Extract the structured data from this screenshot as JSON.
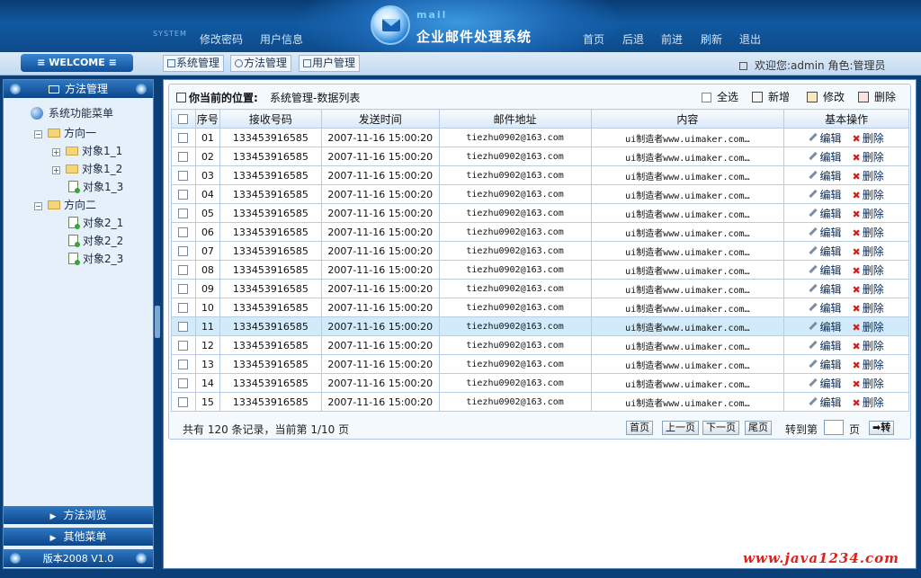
{
  "header": {
    "system_tag": "SYSTEM",
    "left_links": [
      "修改密码",
      "用户信息"
    ],
    "right_links": [
      "首页",
      "后退",
      "前进",
      "刷新",
      "退出"
    ],
    "logo_word": "mail",
    "title": "企业邮件处理系统"
  },
  "navbar": {
    "welcome": "≡ WELCOME ≡",
    "tabs": [
      "系统管理",
      "方法管理",
      "用户管理"
    ],
    "welcome_user": "欢迎您:admin 角色:管理员"
  },
  "sidebar": {
    "top_header": "方法管理",
    "tree": {
      "root": "系统功能菜单",
      "groups": [
        {
          "label": "方向一",
          "items": [
            "对象1_1",
            "对象1_2",
            "对象1_3"
          ]
        },
        {
          "label": "方向二",
          "items": [
            "对象2_1",
            "对象2_2",
            "对象2_3"
          ]
        }
      ]
    },
    "bottom_headers": [
      "方法浏览",
      "其他菜单"
    ],
    "version": "版本2008 V1.0"
  },
  "main": {
    "position_label": "你当前的位置:",
    "position_value": "系统管理-数据列表",
    "toolbar": {
      "select_all": "全选",
      "add": "新增",
      "edit": "修改",
      "delete": "删除"
    },
    "columns": [
      "序号",
      "接收号码",
      "发送时间",
      "邮件地址",
      "内容",
      "基本操作"
    ],
    "row_actions": {
      "edit": "编辑",
      "delete": "删除"
    },
    "rows": [
      {
        "no": "01",
        "phone": "133453916585",
        "time": "2007-11-16 15:00:20",
        "email": "tiezhu0902@163.com",
        "content": "ui制造者www.uimaker.com…"
      },
      {
        "no": "02",
        "phone": "133453916585",
        "time": "2007-11-16 15:00:20",
        "email": "tiezhu0902@163.com",
        "content": "ui制造者www.uimaker.com…"
      },
      {
        "no": "03",
        "phone": "133453916585",
        "time": "2007-11-16 15:00:20",
        "email": "tiezhu0902@163.com",
        "content": "ui制造者www.uimaker.com…"
      },
      {
        "no": "04",
        "phone": "133453916585",
        "time": "2007-11-16 15:00:20",
        "email": "tiezhu0902@163.com",
        "content": "ui制造者www.uimaker.com…"
      },
      {
        "no": "05",
        "phone": "133453916585",
        "time": "2007-11-16 15:00:20",
        "email": "tiezhu0902@163.com",
        "content": "ui制造者www.uimaker.com…"
      },
      {
        "no": "06",
        "phone": "133453916585",
        "time": "2007-11-16 15:00:20",
        "email": "tiezhu0902@163.com",
        "content": "ui制造者www.uimaker.com…"
      },
      {
        "no": "07",
        "phone": "133453916585",
        "time": "2007-11-16 15:00:20",
        "email": "tiezhu0902@163.com",
        "content": "ui制造者www.uimaker.com…"
      },
      {
        "no": "08",
        "phone": "133453916585",
        "time": "2007-11-16 15:00:20",
        "email": "tiezhu0902@163.com",
        "content": "ui制造者www.uimaker.com…"
      },
      {
        "no": "09",
        "phone": "133453916585",
        "time": "2007-11-16 15:00:20",
        "email": "tiezhu0902@163.com",
        "content": "ui制造者www.uimaker.com…"
      },
      {
        "no": "10",
        "phone": "133453916585",
        "time": "2007-11-16 15:00:20",
        "email": "tiezhu0902@163.com",
        "content": "ui制造者www.uimaker.com…"
      },
      {
        "no": "11",
        "phone": "133453916585",
        "time": "2007-11-16 15:00:20",
        "email": "tiezhu0902@163.com",
        "content": "ui制造者www.uimaker.com…",
        "highlight": true
      },
      {
        "no": "12",
        "phone": "133453916585",
        "time": "2007-11-16 15:00:20",
        "email": "tiezhu0902@163.com",
        "content": "ui制造者www.uimaker.com…"
      },
      {
        "no": "13",
        "phone": "133453916585",
        "time": "2007-11-16 15:00:20",
        "email": "tiezhu0902@163.com",
        "content": "ui制造者www.uimaker.com…"
      },
      {
        "no": "14",
        "phone": "133453916585",
        "time": "2007-11-16 15:00:20",
        "email": "tiezhu0902@163.com",
        "content": "ui制造者www.uimaker.com…"
      },
      {
        "no": "15",
        "phone": "133453916585",
        "time": "2007-11-16 15:00:20",
        "email": "tiezhu0902@163.com",
        "content": "ui制造者www.uimaker.com…"
      }
    ],
    "pager": {
      "info": "共有 120 条记录，当前第 1/10 页",
      "buttons": [
        "首页",
        "上一页",
        "下一页",
        "尾页"
      ],
      "goto_label": "转到第",
      "goto_value": "",
      "goto_suffix": "页",
      "go_button": "➡转"
    }
  },
  "watermark": "www.java1234.com",
  "colors": {
    "header_dark": "#0a3c73",
    "accent": "#115aa1",
    "row_highlight": "#d2ebfb",
    "delete_red": "#d02020"
  }
}
